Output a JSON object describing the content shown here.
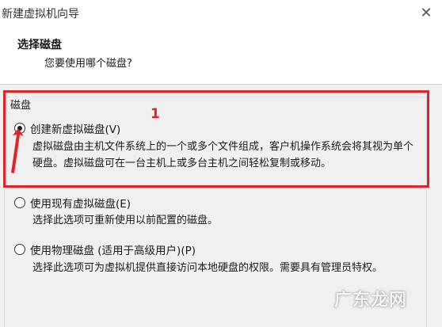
{
  "window": {
    "title": "新建虚拟机向导",
    "close_glyph": "✕"
  },
  "header": {
    "title": "选择磁盘",
    "subtitle": "您要使用哪个磁盘?"
  },
  "group": {
    "label": "磁盘"
  },
  "options": [
    {
      "label": "创建新虚拟磁盘(V)",
      "checked": true,
      "description": "虚拟磁盘由主机文件系统上的一个或多个文件组成，客户机操作系统会将其视为单个硬盘。虚拟磁盘可在一台主机上或多台主机之间轻松复制或移动。"
    },
    {
      "label": "使用现有虚拟磁盘(E)",
      "checked": false,
      "description": "选择此选项可重新使用以前配置的磁盘。"
    },
    {
      "label": "使用物理磁盘 (适用于高级用户)(P)",
      "checked": false,
      "description": "选择此选项可为虚拟机提供直接访问本地硬盘的权限。需要具有管理员特权。"
    }
  ],
  "annotation": {
    "number": "1",
    "color": "#e2232a"
  },
  "watermark": "广东龙网"
}
